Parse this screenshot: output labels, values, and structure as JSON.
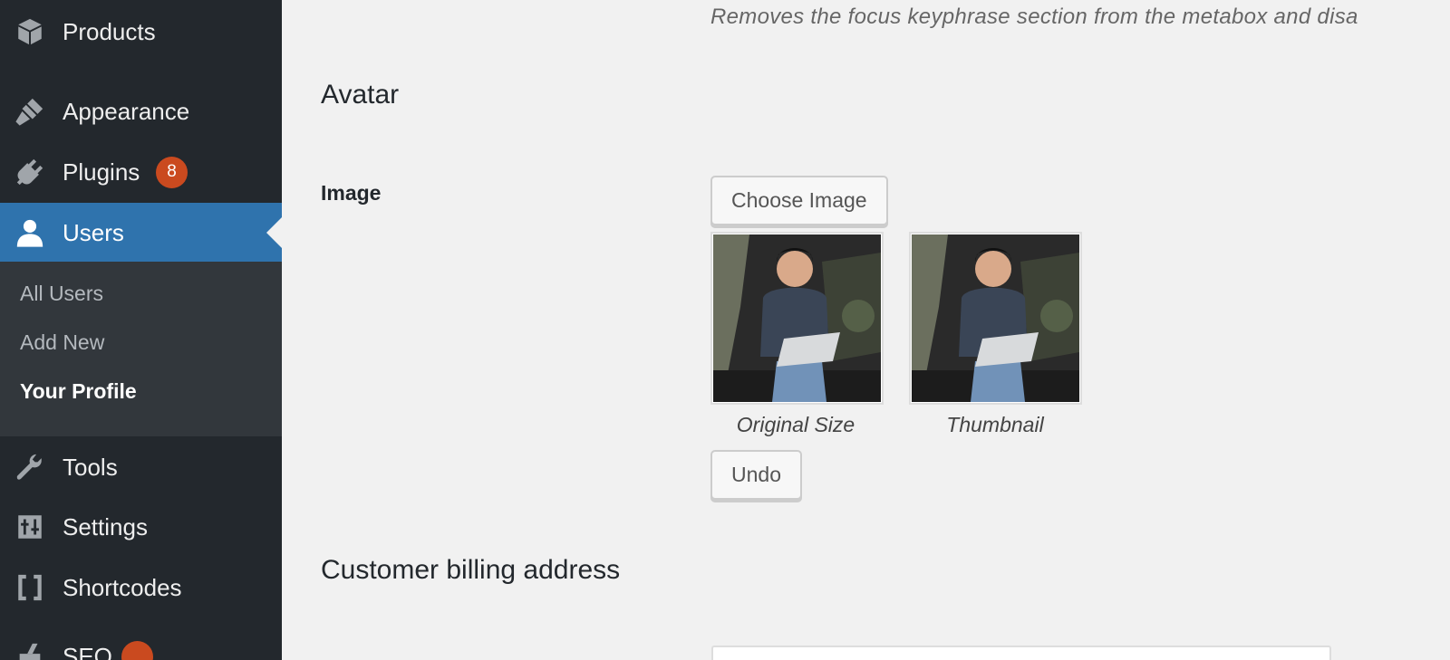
{
  "sidebar": {
    "items": [
      {
        "label": "Products",
        "icon": "box-icon"
      },
      {
        "label": "Appearance",
        "icon": "brush-icon"
      },
      {
        "label": "Plugins",
        "icon": "plug-icon",
        "badge": "8"
      },
      {
        "label": "Users",
        "icon": "user-icon",
        "active": true
      },
      {
        "label": "Tools",
        "icon": "wrench-icon"
      },
      {
        "label": "Settings",
        "icon": "sliders-icon"
      },
      {
        "label": "Shortcodes",
        "icon": "brackets-icon"
      },
      {
        "label": "SEO",
        "icon": "seo-icon"
      }
    ],
    "submenu": [
      {
        "label": "All Users"
      },
      {
        "label": "Add New"
      },
      {
        "label": "Your Profile",
        "current": true
      }
    ],
    "colors": {
      "background": "#23282d",
      "active": "#2f73ad",
      "submenu": "#32373c",
      "badge": "#ca4a1f"
    }
  },
  "main": {
    "focus_description": "Removes the focus keyphrase section from the metabox and disa",
    "avatar_heading": "Avatar",
    "image_label": "Image",
    "choose_image_label": "Choose Image",
    "original_size_caption": "Original Size",
    "thumbnail_caption": "Thumbnail",
    "undo_label": "Undo",
    "billing_heading": "Customer billing address"
  }
}
